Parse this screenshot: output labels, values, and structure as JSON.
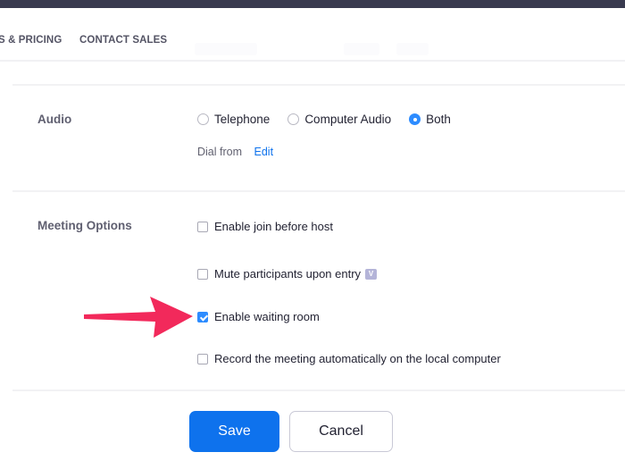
{
  "header": {
    "nav": [
      {
        "label": "S & PRICING"
      },
      {
        "label": "CONTACT SALES"
      }
    ]
  },
  "audio": {
    "label": "Audio",
    "options": [
      {
        "label": "Telephone",
        "selected": false
      },
      {
        "label": "Computer Audio",
        "selected": false
      },
      {
        "label": "Both",
        "selected": true
      }
    ],
    "dial_from_label": "Dial from",
    "edit_label": "Edit"
  },
  "meeting_options": {
    "label": "Meeting Options",
    "items": [
      {
        "label": "Enable join before host",
        "checked": false
      },
      {
        "label": "Mute participants upon entry",
        "checked": false,
        "badge": "V"
      },
      {
        "label": "Enable waiting room",
        "checked": true
      },
      {
        "label": "Record the meeting automatically on the local computer",
        "checked": false
      }
    ]
  },
  "actions": {
    "save_label": "Save",
    "cancel_label": "Cancel"
  },
  "colors": {
    "primary": "#0e72ed",
    "radio_checked": "#2d8cff",
    "annotation_arrow": "#f2295b",
    "topbar": "#393a4f"
  }
}
